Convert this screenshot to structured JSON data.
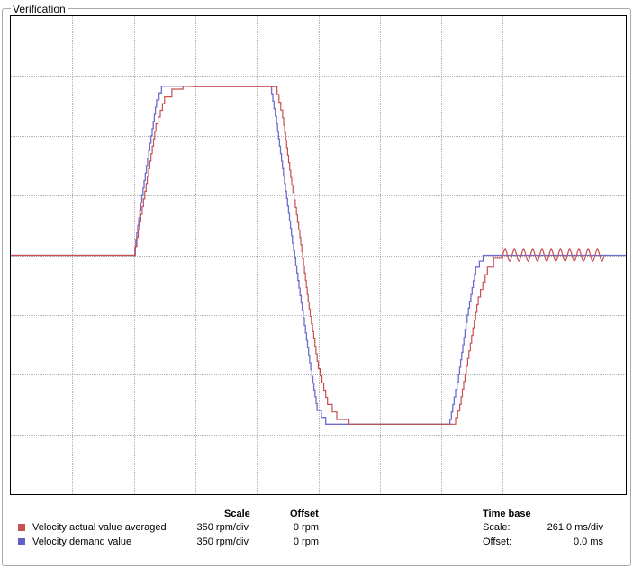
{
  "panel": {
    "title": "Verification"
  },
  "chart_data": {
    "type": "line",
    "grid": true,
    "divisions": {
      "x": 10,
      "y": 8
    },
    "x_scale_ms_per_div": 261.0,
    "y_scale_rpm_per_div": 350,
    "series": [
      {
        "name": "Velocity demand value",
        "color": "#6d6dd0",
        "x_div": [
          0,
          2.0,
          2.13,
          2.28,
          2.37,
          2.45,
          4.22,
          4.32,
          4.45,
          4.58,
          4.72,
          4.86,
          4.98,
          5.12,
          5.14,
          7.12,
          7.14,
          7.28,
          7.42,
          7.56,
          7.68,
          10.0
        ],
        "y_div": [
          0,
          0,
          1.0,
          2.0,
          2.6,
          2.83,
          2.83,
          2.2,
          1.2,
          0.2,
          -0.8,
          -1.8,
          -2.6,
          -2.83,
          -2.83,
          -2.83,
          -2.75,
          -2.0,
          -1.0,
          -0.2,
          0.0,
          0.0
        ]
      },
      {
        "name": "Velocity actual value averaged",
        "color": "#c85050",
        "x_div": [
          0,
          2.0,
          2.05,
          2.2,
          2.36,
          2.5,
          2.62,
          2.8,
          3.0,
          4.3,
          4.42,
          4.55,
          4.7,
          4.85,
          5.0,
          5.15,
          5.3,
          5.5,
          5.8,
          7.2,
          7.3,
          7.45,
          7.6,
          7.75,
          7.85,
          8.0
        ],
        "y_div": [
          0,
          0,
          0.3,
          1.2,
          2.2,
          2.65,
          2.78,
          2.83,
          2.82,
          2.82,
          2.3,
          1.3,
          0.3,
          -0.9,
          -1.9,
          -2.5,
          -2.75,
          -2.83,
          -2.83,
          -2.83,
          -2.5,
          -1.6,
          -0.7,
          -0.2,
          -0.05,
          0.0
        ],
        "oscillation": {
          "from_div": 8.0,
          "to_div": 9.65,
          "amplitude_div": 0.1,
          "cycles": 11
        }
      }
    ]
  },
  "legend": {
    "headers": {
      "scale": "Scale",
      "offset": "Offset"
    },
    "items": [
      {
        "label": "Velocity actual value averaged",
        "color": "#c85050",
        "scale": "350 rpm/div",
        "offset": "0 rpm"
      },
      {
        "label": "Velocity demand value",
        "color": "#6060c8",
        "scale": "350 rpm/div",
        "offset": "0 rpm"
      }
    ]
  },
  "time_base": {
    "header": "Time base",
    "scale_label": "Scale:",
    "scale_value": "261.0 ms/div",
    "offset_label": "Offset:",
    "offset_value": "0.0 ms"
  }
}
